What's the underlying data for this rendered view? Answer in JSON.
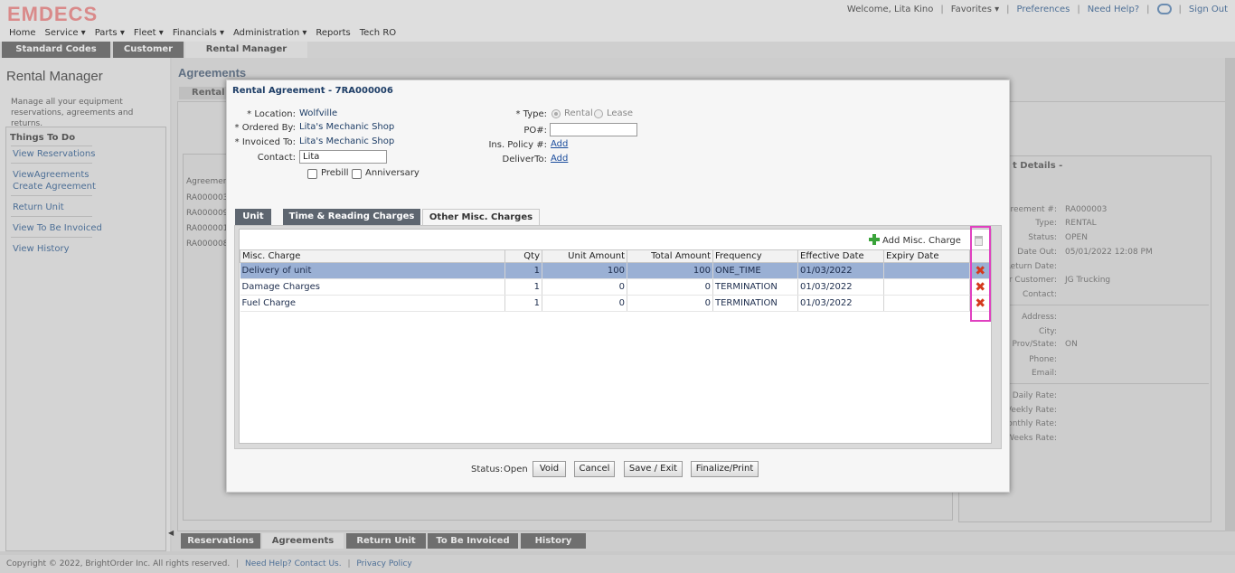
{
  "app": {
    "logo": "EMDECS",
    "welcome": "Welcome, Lita Kino",
    "favorites": "Favorites ▾",
    "preferences": "Preferences",
    "help": "Need Help?",
    "signout": "Sign Out",
    "menu": [
      "Home",
      "Service ▾",
      "Parts ▾",
      "Fleet ▾",
      "Financials ▾",
      "Administration ▾",
      "Reports",
      "Tech RO"
    ],
    "main_tabs": [
      "Standard Codes",
      "Customer",
      "Rental Manager"
    ]
  },
  "left_panel": {
    "title": "Rental Manager",
    "description": "Manage all your equipment reservations, agreements and returns.",
    "todo_title": "Things To Do",
    "todo_items": [
      "View Reservations",
      "ViewAgreements",
      "Create Agreement",
      "Return Unit",
      "View To Be Invoiced",
      "View History"
    ]
  },
  "agreements": {
    "title": "Agreements",
    "subtab": "Rental",
    "list_header": "Agreemen",
    "list_rows": [
      "RA000003",
      "RA000009",
      "RA000001",
      "RA000008"
    ]
  },
  "details": {
    "title": "t Details -",
    "fields": [
      {
        "label": "greement #:",
        "value": "RA000003"
      },
      {
        "label": "Type:",
        "value": "RENTAL"
      },
      {
        "label": "Status:",
        "value": "OPEN"
      },
      {
        "label": "Date Out:",
        "value": "05/01/2022 12:08 PM"
      },
      {
        "label": "Return Date:",
        "value": ""
      },
      {
        "label": "r Customer:",
        "value": "JG Trucking"
      },
      {
        "label": "Contact:",
        "value": ""
      },
      {
        "label": "Address:",
        "value": ""
      },
      {
        "label": "City:",
        "value": ""
      },
      {
        "label": "Prov/State:",
        "value": "ON"
      },
      {
        "label": "Phone:",
        "value": ""
      },
      {
        "label": "Email:",
        "value": ""
      },
      {
        "label": "Daily Rate:",
        "value": ""
      },
      {
        "label": "Veekly Rate:",
        "value": ""
      },
      {
        "label": "onthly Rate:",
        "value": ""
      },
      {
        "label": "Weeks Rate:",
        "value": ""
      }
    ]
  },
  "bottom_tabs": [
    "Reservations",
    "Agreements",
    "Return Unit",
    "To Be Invoiced",
    "History"
  ],
  "footer": {
    "copyright": "Copyright © 2022, BrightOrder Inc. All rights reserved.",
    "help": "Need Help? Contact Us.",
    "privacy": "Privacy Policy"
  },
  "modal": {
    "title": "Rental Agreement - 7RA000006",
    "location_label": "* Location:",
    "location": "Wolfville",
    "ordered_by_label": "* Ordered By:",
    "ordered_by": "Lita's Mechanic Shop",
    "invoiced_to_label": "* Invoiced To:",
    "invoiced_to": "Lita's Mechanic Shop",
    "contact_label": "Contact:",
    "contact_value": "Lita",
    "prebill_label": "Prebill",
    "anniversary_label": "Anniversary",
    "type_label": "* Type:",
    "type_options": [
      "Rental",
      "Lease"
    ],
    "type_selected": "Rental",
    "po_label": "PO#:",
    "po_value": "",
    "ins_label": "Ins. Policy #:",
    "ins_link": "Add",
    "deliver_label": "DeliverTo:",
    "deliver_link": "Add",
    "tabs": [
      "Unit",
      "Time & Reading Charges",
      "Other Misc. Charges"
    ],
    "active_tab": "Other Misc. Charges",
    "add_misc_label": "Add Misc. Charge",
    "columns": [
      "Misc. Charge",
      "Qty",
      "Unit Amount",
      "Total Amount",
      "Frequency",
      "Effective Date",
      "Expiry Date"
    ],
    "rows": [
      {
        "charge": "Delivery of unit",
        "qty": "1",
        "unit_amount": "100",
        "total_amount": "100",
        "frequency": "ONE_TIME",
        "effective": "01/03/2022",
        "expiry": ""
      },
      {
        "charge": "Damage Charges",
        "qty": "1",
        "unit_amount": "0",
        "total_amount": "0",
        "frequency": "TERMINATION",
        "effective": "01/03/2022",
        "expiry": ""
      },
      {
        "charge": "Fuel Charge",
        "qty": "1",
        "unit_amount": "0",
        "total_amount": "0",
        "frequency": "TERMINATION",
        "effective": "01/03/2022",
        "expiry": ""
      }
    ],
    "status_label": "Status:",
    "status_value": "Open",
    "buttons": {
      "void": "Void",
      "cancel": "Cancel",
      "save_exit": "Save / Exit",
      "finalize": "Finalize/Print"
    }
  },
  "colors": {
    "accent": "#1d3d66",
    "link": "#1a4c9c",
    "selected_row": "#9ab0d4",
    "highlight": "#e040c0",
    "delete": "#d33a1e"
  }
}
